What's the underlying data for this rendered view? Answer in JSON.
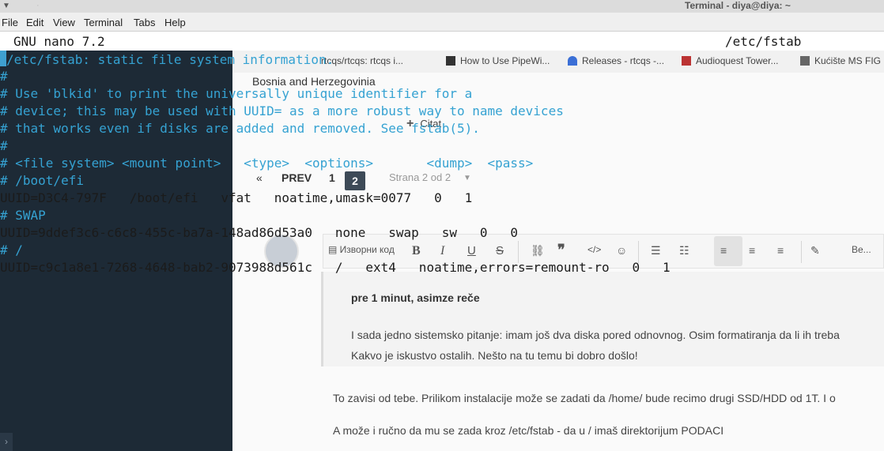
{
  "window": {
    "title": "Terminal - diya@diya: ~",
    "menu": [
      "File",
      "Edit",
      "View",
      "Terminal",
      "Tabs",
      "Help"
    ]
  },
  "nano": {
    "version": "GNU nano 7.2",
    "filename": "/etc/fstab",
    "lines": [
      {
        "text": "/etc/fstab: static file system information.",
        "type": "comment",
        "cursor_prefix": true
      },
      {
        "text": "#",
        "type": "comment"
      },
      {
        "text": "# Use 'blkid' to print the universally unique identifier for a",
        "type": "comment"
      },
      {
        "text": "# device; this may be used with UUID= as a more robust way to name devices",
        "type": "comment"
      },
      {
        "text": "# that works even if disks are added and removed. See fstab(5).",
        "type": "comment"
      },
      {
        "text": "#",
        "type": "comment"
      },
      {
        "text": "# <file system> <mount point>   <type>  <options>       <dump>  <pass>",
        "type": "comment"
      },
      {
        "text": "# /boot/efi",
        "type": "comment"
      },
      {
        "text": "UUID=D3C4-797F   /boot/efi   vfat   noatime,umask=0077   0   1",
        "type": "code"
      },
      {
        "text": "# SWAP",
        "type": "comment"
      },
      {
        "text": "UUID=9ddef3c6-c6c8-455c-ba7a-148ad86d53a0   none   swap   sw   0   0",
        "type": "code"
      },
      {
        "text": "# /",
        "type": "comment"
      },
      {
        "text": "UUID=c9c1a8e1-7268-4648-bab2-9073988d561c   /   ext4   noatime,errors=remount-ro   0   1",
        "type": "code"
      }
    ]
  },
  "background_browser": {
    "bookmarks": [
      "How to Use PipeWi...",
      "Releases - rtcqs -...",
      "Audioquest Tower...",
      "Kućište MS FIG"
    ],
    "bookmark_partial": "rtcqs/rtcqs: rtcqs i...",
    "country": "Bosnia and Herzegovinia",
    "citat": "Citat",
    "pager": {
      "prev": "PREV",
      "pages": [
        "1",
        "2"
      ],
      "current": "2",
      "info": "Strana 2 od 2"
    },
    "toolbar": {
      "source": "Изворни код",
      "paragraph": "Ве..."
    },
    "quote_author": "pre 1 minut, asimze reče",
    "quote_line1": "I sada jedno sistemsko pitanje: imam još dva diska pored odnovnog. Osim formatiranja  da li ih treba",
    "quote_line2": "Kakvo je iskustvo ostalih. Nešto na tu temu bi dobro došlo!",
    "para1": "To zavisi od tebe. Prilikom instalacije može se zadati da /home/ bude recimo drugi SSD/HDD od 1T. I o",
    "para2": "A može i ručno da mu se zada kroz /etc/fstab - da u /  imaš direktorijum PODACI"
  },
  "colors": {
    "comment": "#35a2d2",
    "code": "#1b1b1b",
    "terminal_bg": "#1d2a36"
  }
}
